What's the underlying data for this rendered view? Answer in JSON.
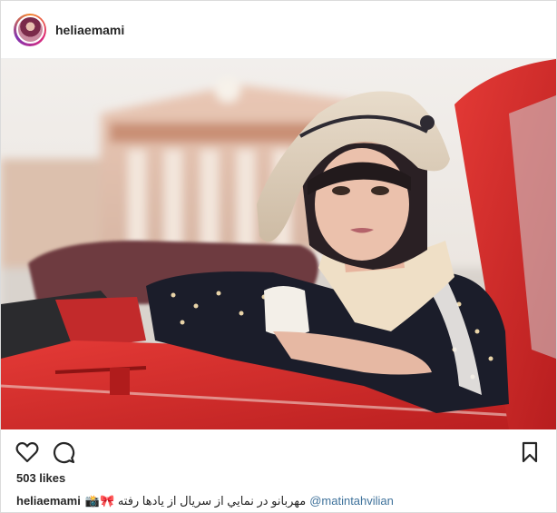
{
  "header": {
    "username": "heliaemami",
    "avatar_icon": "profile-avatar"
  },
  "photo": {
    "subject": "photo"
  },
  "actions": {
    "like_icon": "heart-outline-icon",
    "comment_icon": "comment-bubble-icon",
    "save_icon": "bookmark-icon"
  },
  "likes": {
    "text": "503 likes"
  },
  "caption": {
    "username": "heliaemami",
    "text": "مهربانو در نمايي از سريال از يادها رفته 🎀📸",
    "mention": "@matintahvilian"
  },
  "colors": {
    "text": "#262626",
    "border": "#dbdbdb",
    "mention": "#3f729b",
    "car_red": "#d42a2a"
  }
}
